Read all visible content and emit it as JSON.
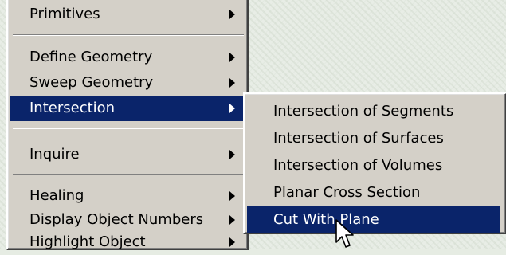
{
  "main_menu": {
    "items": [
      {
        "label": "Primitives",
        "has_submenu": true
      },
      {
        "label": "Define Geometry",
        "has_submenu": true
      },
      {
        "label": "Sweep Geometry",
        "has_submenu": true
      },
      {
        "label": "Intersection",
        "has_submenu": true,
        "selected": true
      },
      {
        "label": "Inquire",
        "has_submenu": true
      },
      {
        "label": "Healing",
        "has_submenu": true
      },
      {
        "label": "Display Object Numbers",
        "has_submenu": true
      },
      {
        "label": "Highlight Object",
        "has_submenu": true
      }
    ]
  },
  "submenu": {
    "parent": "Intersection",
    "items": [
      {
        "label": "Intersection of Segments"
      },
      {
        "label": "Intersection of Surfaces"
      },
      {
        "label": "Intersection of Volumes"
      },
      {
        "label": "Planar Cross Section"
      },
      {
        "label": "Cut With Plane",
        "selected": true
      }
    ]
  },
  "colors": {
    "menu_face": "#d4d0c8",
    "highlight": "#0a246a",
    "highlight_text": "#ffffff",
    "background": "#e6ece3"
  },
  "icons": {
    "submenu_arrow": "triangle-right-icon",
    "cursor": "arrow-cursor-icon"
  }
}
